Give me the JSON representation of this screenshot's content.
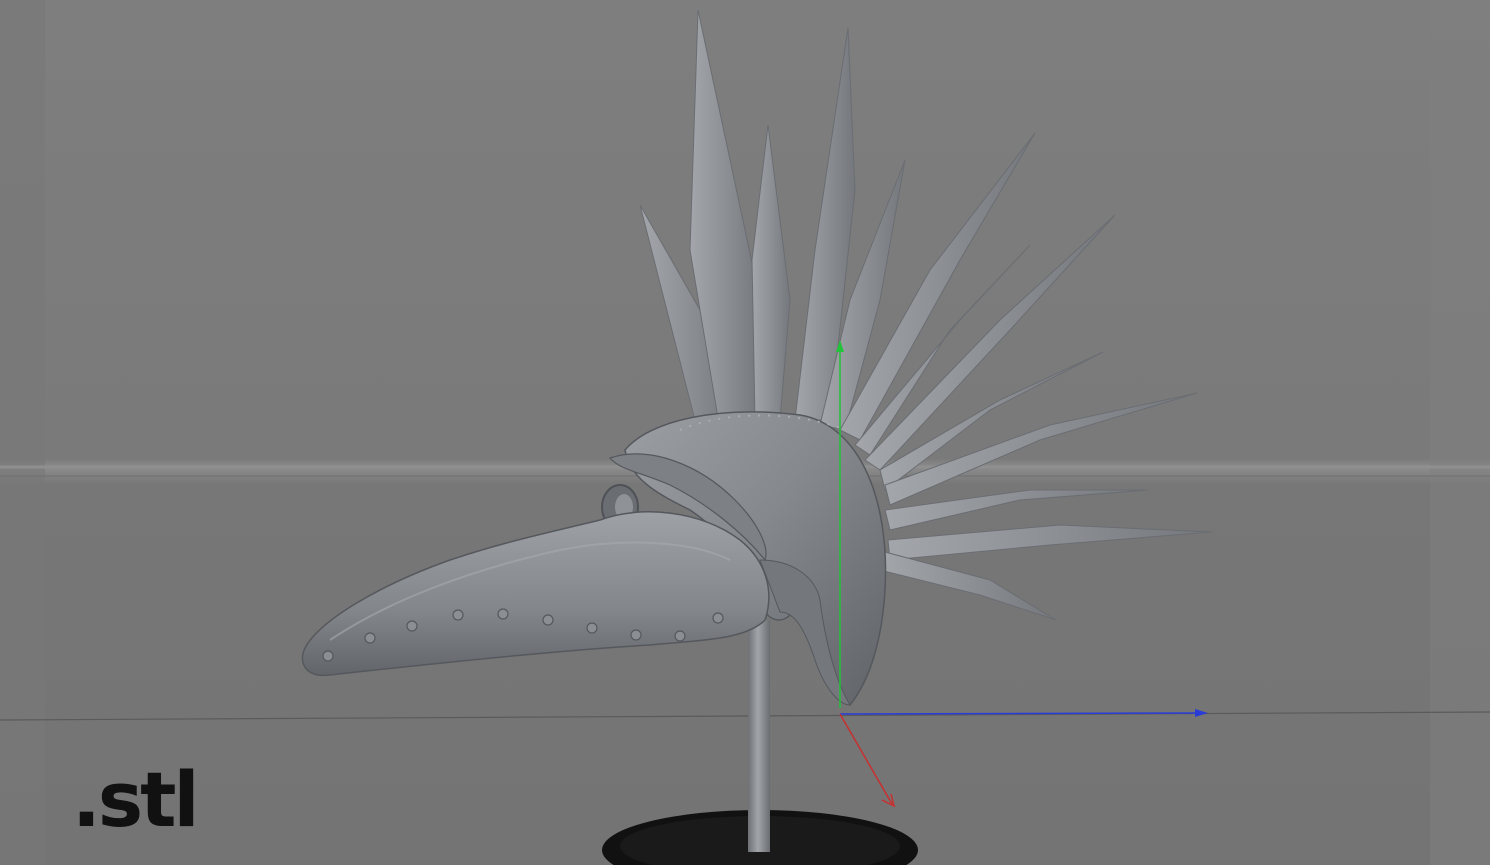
{
  "viewport": {
    "background_color": "#7b7b7b",
    "floor_color": "#767676",
    "horizon_color": "#8a8a8a"
  },
  "model": {
    "name_icon": "plague-doctor-helmet-icon",
    "material_color": "#8c8f94",
    "material_shadow": "#5f6166",
    "stand_color": "#85878b",
    "base_color": "#111111",
    "spike_color": "#9a9da2"
  },
  "gizmo": {
    "x_axis_color": "#c83030",
    "y_axis_color": "#22c23a",
    "z_axis_color": "#2a3cd8"
  },
  "file_label": ".stl"
}
